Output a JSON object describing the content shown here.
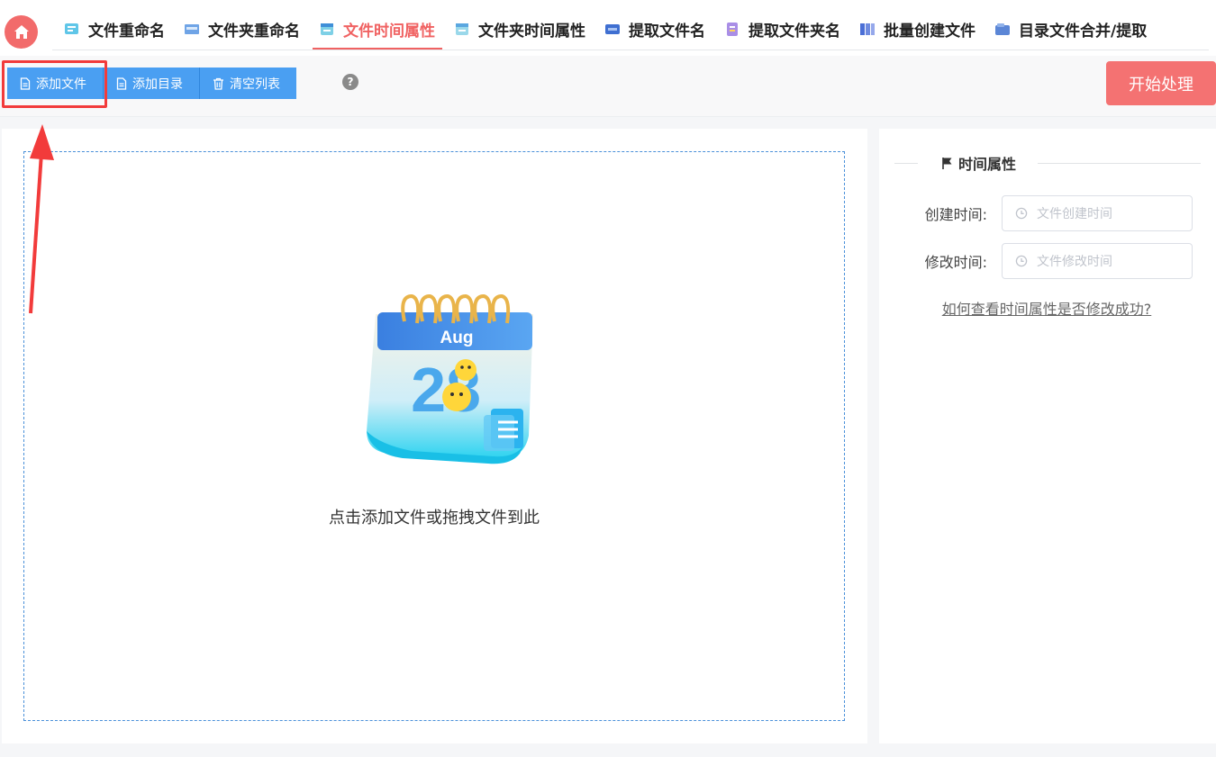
{
  "nav": {
    "tabs": [
      {
        "label": "文件重命名",
        "icon": "file-rename-icon"
      },
      {
        "label": "文件夹重命名",
        "icon": "folder-rename-icon"
      },
      {
        "label": "文件时间属性",
        "icon": "file-time-icon"
      },
      {
        "label": "文件夹时间属性",
        "icon": "folder-time-icon"
      },
      {
        "label": "提取文件名",
        "icon": "extract-filename-icon"
      },
      {
        "label": "提取文件夹名",
        "icon": "extract-foldername-icon"
      },
      {
        "label": "批量创建文件",
        "icon": "batch-create-icon"
      },
      {
        "label": "目录文件合并/提取",
        "icon": "merge-extract-icon"
      }
    ],
    "active_tab": "文件时间属性"
  },
  "toolbar": {
    "add_file": "添加文件",
    "add_dir": "添加目录",
    "clear_list": "清空列表",
    "help": "?",
    "start": "开始处理"
  },
  "dropzone": {
    "text": "点击添加文件或拖拽文件到此",
    "illustration_month": "Aug",
    "illustration_day": "28"
  },
  "time_panel": {
    "title": "时间属性",
    "create_label": "创建时间:",
    "create_placeholder": "文件创建时间",
    "modify_label": "修改时间:",
    "modify_placeholder": "文件修改时间",
    "help_link": "如何查看时间属性是否修改成功?"
  },
  "colors": {
    "accent_red": "#f06262",
    "button_blue": "#4a9ff2",
    "start_button": "#f47272",
    "highlight": "#f23b3b"
  }
}
